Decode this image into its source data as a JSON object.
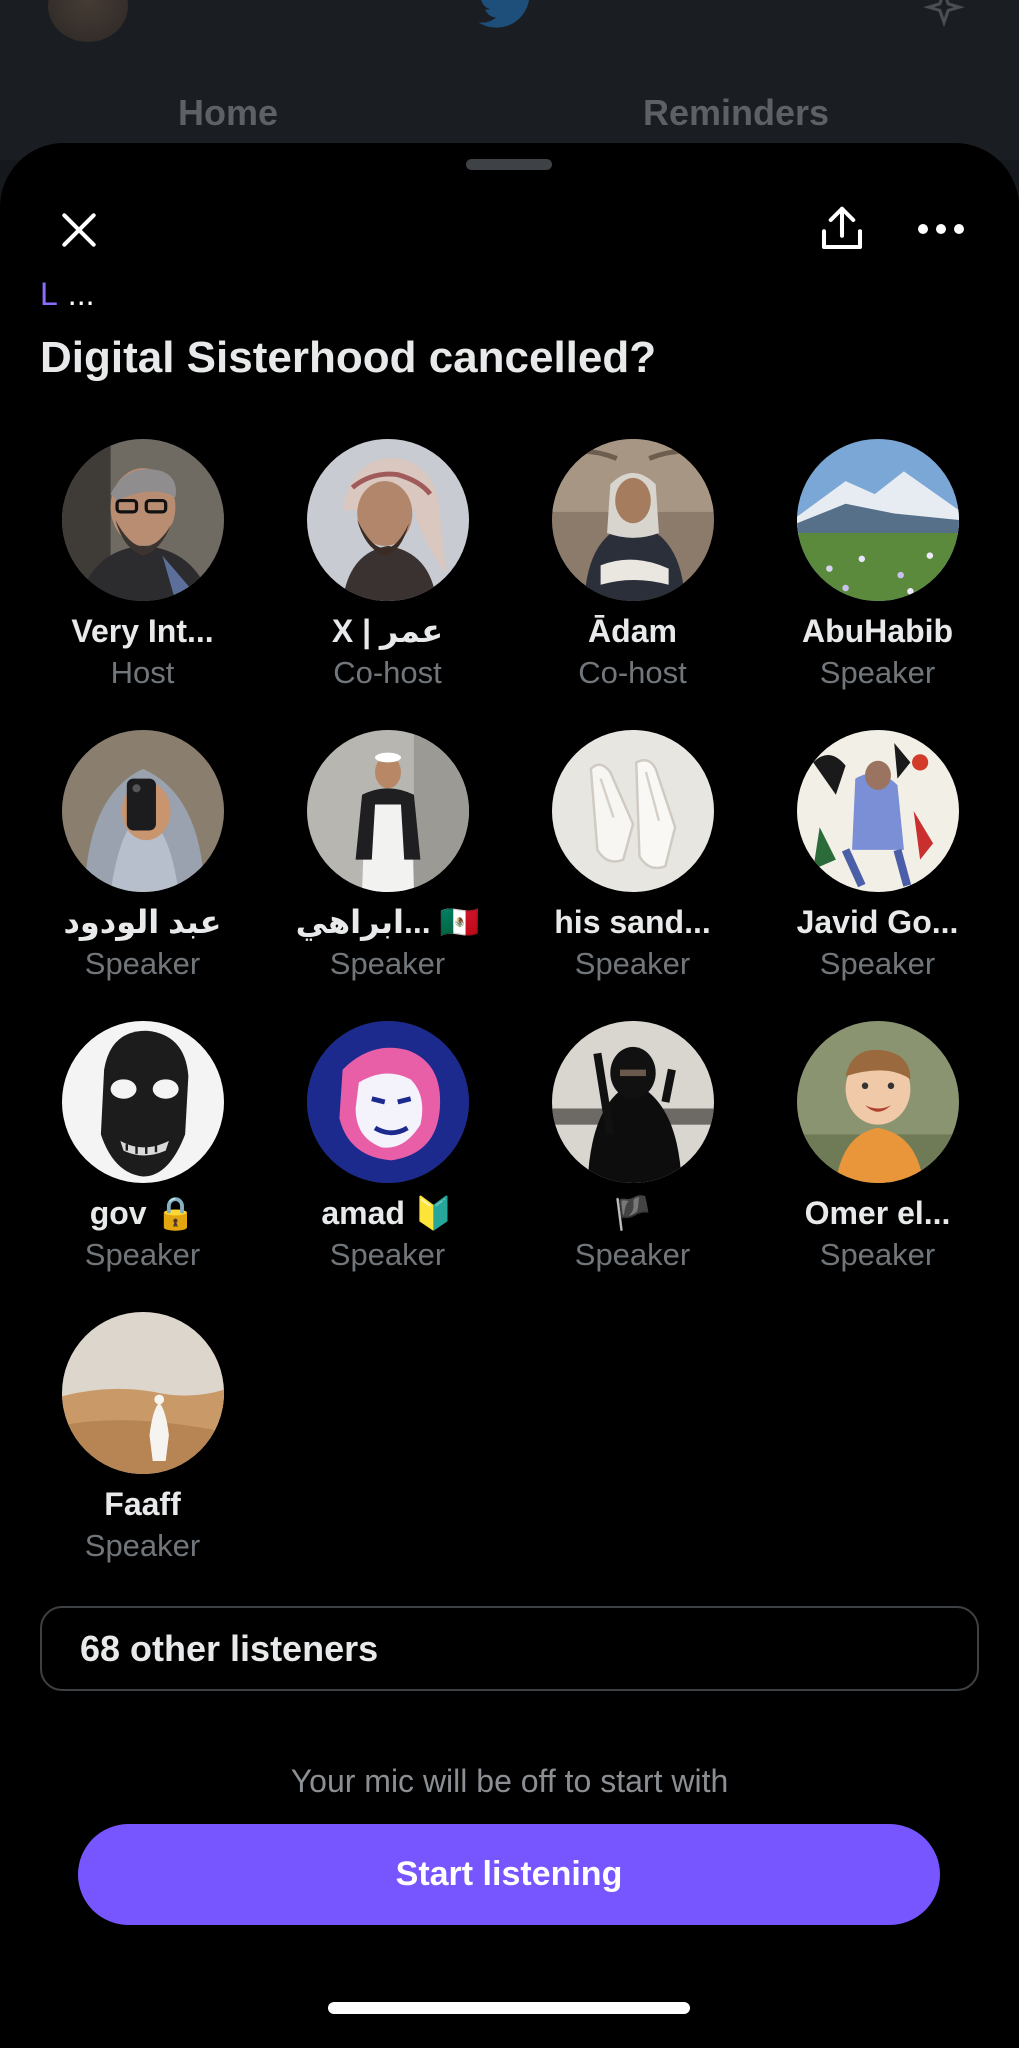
{
  "background": {
    "tabs": [
      "Home",
      "Reminders"
    ]
  },
  "header": {
    "space_tag_letter": "L",
    "space_tag_more": "...",
    "title": "Digital Sisterhood cancelled?"
  },
  "participants": [
    {
      "name": "Very Int...",
      "role": "Host",
      "avatar": "man-glasses-beard"
    },
    {
      "name": "X | عمر",
      "role": "Co-host",
      "avatar": "man-shemagh"
    },
    {
      "name": "Ādam",
      "role": "Co-host",
      "avatar": "man-seated-robe"
    },
    {
      "name": "AbuHabib",
      "role": "Speaker",
      "avatar": "mountain-meadow"
    },
    {
      "name": "عبد الودود",
      "role": "Speaker",
      "avatar": "mirror-selfie"
    },
    {
      "name": "ابراهي... 🇲🇽",
      "role": "Speaker",
      "avatar": "man-white-thobe"
    },
    {
      "name": "his sand...",
      "role": "Speaker",
      "avatar": "white-gloves"
    },
    {
      "name": "Javid Go...",
      "role": "Speaker",
      "avatar": "illustration-art"
    },
    {
      "name": "gov 🔒",
      "role": "Speaker",
      "avatar": "black-mask"
    },
    {
      "name": "amad 🔰",
      "role": "Speaker",
      "avatar": "lion-logo"
    },
    {
      "name": "🏴",
      "role": "Speaker",
      "avatar": "dark-figure"
    },
    {
      "name": "Omer el...",
      "role": "Speaker",
      "avatar": "child-smiling"
    },
    {
      "name": "Faaff",
      "role": "Speaker",
      "avatar": "desert-figure"
    }
  ],
  "listeners_label": "68 other listeners",
  "mic_note": "Your mic will be off to start with",
  "start_button": "Start listening",
  "colors": {
    "accent": "#7856ff",
    "tag_letter": "#8b6cff",
    "muted_text": "#71767b"
  }
}
